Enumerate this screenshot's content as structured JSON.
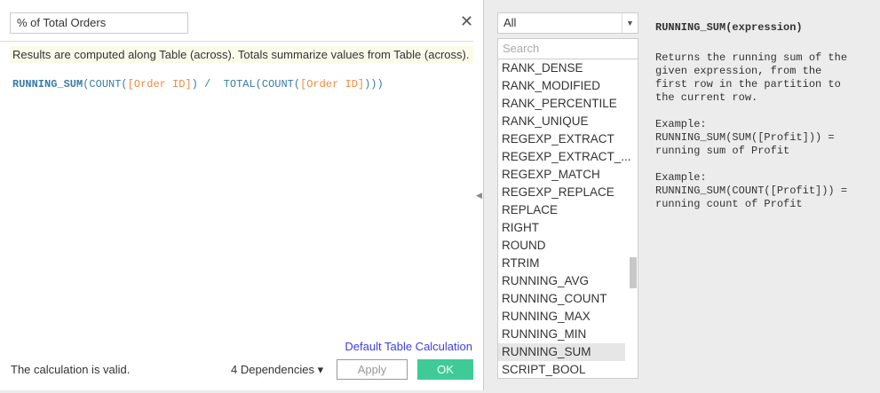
{
  "calc_name": "% of Total Orders",
  "info": "Results are computed along Table (across).  Totals summarize values from Table (across).",
  "formula": {
    "f1": "RUNNING_SUM",
    "p1": "(COUNT(",
    "fld1": "[Order ID]",
    "p2": ") /  TOTAL(COUNT(",
    "fld2": "[Order ID]",
    "p3": ")))"
  },
  "default_table_calc": "Default Table Calculation",
  "status": "The calculation is valid.",
  "dependencies": "4 Dependencies ▾",
  "apply": "Apply",
  "ok": "OK",
  "filter": "All",
  "search_placeholder": "Search",
  "functions": [
    "RANK_DENSE",
    "RANK_MODIFIED",
    "RANK_PERCENTILE",
    "RANK_UNIQUE",
    "REGEXP_EXTRACT",
    "REGEXP_EXTRACT_...",
    "REGEXP_MATCH",
    "REGEXP_REPLACE",
    "REPLACE",
    "RIGHT",
    "ROUND",
    "RTRIM",
    "RUNNING_AVG",
    "RUNNING_COUNT",
    "RUNNING_MAX",
    "RUNNING_MIN",
    "RUNNING_SUM",
    "SCRIPT_BOOL"
  ],
  "selected_function": "RUNNING_SUM",
  "help": {
    "title": "RUNNING_SUM(expression)",
    "desc": "Returns the running sum of the\ngiven expression, from the\nfirst row in the partition to\nthe current row.",
    "ex1": "Example:\nRUNNING_SUM(SUM([Profit])) =\nrunning sum of Profit",
    "ex2": "Example:\nRUNNING_SUM(COUNT([Profit])) =\nrunning count of Profit"
  }
}
